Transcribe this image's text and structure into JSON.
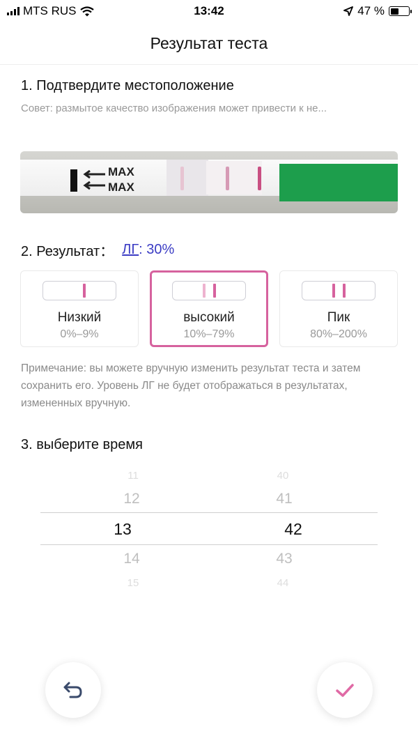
{
  "status_bar": {
    "carrier": "MTS RUS",
    "time": "13:42",
    "battery_percent": "47 %",
    "battery_level": 0.47
  },
  "header": {
    "title": "Результат теста"
  },
  "section1": {
    "title": "1. Подтвердите местоположение",
    "tip": "Совет: размытое качество изображения может привести к не...",
    "strip_text": [
      "MAX",
      "MAX"
    ]
  },
  "section2": {
    "prefix": "2. Результат：",
    "hormone": "ЛГ",
    "value": ": 30%",
    "cards": [
      {
        "label": "Низкий",
        "range": "0%–9%",
        "selected": false
      },
      {
        "label": "высокий",
        "range": "10%–79%",
        "selected": true
      },
      {
        "label": "Пик",
        "range": "80%–200%",
        "selected": false
      }
    ],
    "note": "Примечание: вы можете вручную изменить результат теста и затем сохранить его. Уровень ЛГ не будет отображаться в результатах, измененных вручную."
  },
  "section3": {
    "title": "3. выберите время",
    "hours": [
      "11",
      "12",
      "13",
      "14",
      "15"
    ],
    "minutes": [
      "40",
      "41",
      "42",
      "43",
      "44"
    ],
    "selected_hour": "13",
    "selected_minute": "42"
  },
  "colors": {
    "accent": "#d6629e",
    "link": "#3b3cc4",
    "back_icon": "#3a4a6b",
    "check_icon": "#e06aa5"
  },
  "icons": {
    "back": "undo-arrow-icon",
    "confirm": "checkmark-icon",
    "wifi": "wifi-icon",
    "location": "location-arrow-icon"
  }
}
